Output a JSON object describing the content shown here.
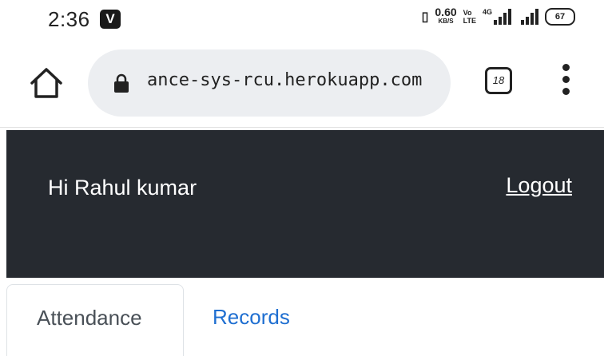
{
  "status_bar": {
    "time": "2:36",
    "notification_badge": "V",
    "net_speed_value": "0.60",
    "net_speed_unit": "KB/S",
    "volte_top": "Vo",
    "volte_bottom": "LTE",
    "network_type": "4G",
    "battery": "67"
  },
  "browser": {
    "url": "ance-sys-rcu.herokuapp.com",
    "tab_count": "18"
  },
  "header": {
    "greeting": "Hi Rahul kumar",
    "logout_label": "Logout"
  },
  "tabs": [
    {
      "label": "Attendance",
      "active": true
    },
    {
      "label": "Records",
      "active": false
    }
  ],
  "colors": {
    "navbar_bg": "#262a30",
    "link": "#1f6fd1",
    "url_pill_bg": "#eceef1"
  }
}
